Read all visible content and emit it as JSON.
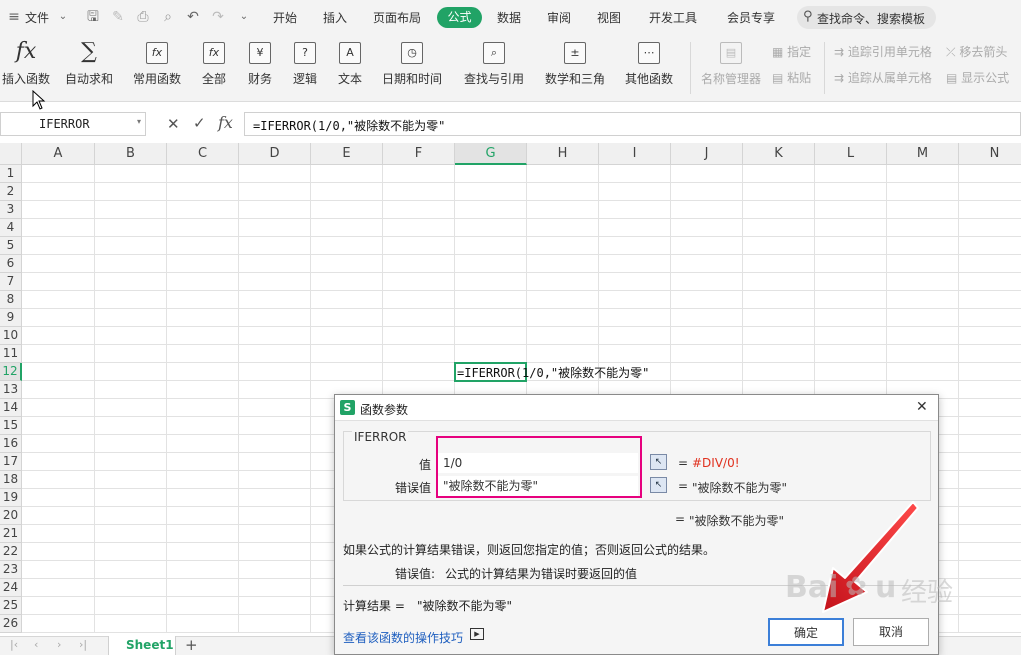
{
  "menubar": {
    "file_label": "文件",
    "tabs": [
      "开始",
      "插入",
      "页面布局",
      "公式",
      "数据",
      "审阅",
      "视图",
      "开发工具",
      "会员专享"
    ],
    "active_tab": "公式",
    "search_placeholder": "查找命令、搜索模板"
  },
  "ribbon": {
    "insert_function": "插入函数",
    "autosum": "自动求和",
    "common_functions": "常用函数",
    "all": "全部",
    "finance": "财务",
    "logic": "逻辑",
    "text": "文本",
    "datetime": "日期和时间",
    "lookup": "查找与引用",
    "math": "数学和三角",
    "other": "其他函数",
    "name_manager": "名称管理器",
    "specify": "指定",
    "paste": "粘贴",
    "trace_precedents": "追踪引用单元格",
    "trace_dependents": "追踪从属单元格",
    "remove_arrows": "移去箭头",
    "show_formulas": "显示公式",
    "icons": {
      "insert_function": "fx",
      "autosum": "∑",
      "common_functions": "fx",
      "all": "fx",
      "finance": "¥",
      "logic": "?",
      "text": "A"
    }
  },
  "formula_bar": {
    "name_box": "IFERROR",
    "formula": "=IFERROR(1/0,\"被除数不能为零\""
  },
  "grid": {
    "columns": [
      "A",
      "B",
      "C",
      "D",
      "E",
      "F",
      "G",
      "H",
      "I",
      "J",
      "K",
      "L",
      "M",
      "N"
    ],
    "rows": [
      "1",
      "2",
      "3",
      "4",
      "5",
      "6",
      "7",
      "8",
      "9",
      "10",
      "11",
      "12",
      "13",
      "14",
      "15",
      "16",
      "17",
      "18",
      "19",
      "20",
      "21",
      "22",
      "23",
      "24",
      "25",
      "26"
    ],
    "active_column": "G",
    "active_row": "12",
    "cell_text": "=IFERROR(1/0,\"被除数不能为零\""
  },
  "sheet_tabs": {
    "active": "Sheet1",
    "add": "+"
  },
  "dialog": {
    "title": "函数参数",
    "function_name": "IFERROR",
    "value_label": "值",
    "value_input": "1/0",
    "value_result": "#DIV/0!",
    "error_label": "错误值",
    "error_input": "\"被除数不能为零\"",
    "error_result": "\"被除数不能为零\"",
    "equals": "=",
    "overall_result": "\"被除数不能为零\"",
    "description": "如果公式的计算结果错误，则返回您指定的值；否则返回公式的结果。",
    "param_help_name": "错误值:",
    "param_help_text": "公式的计算结果为错误时要返回的值",
    "calc_result_label": "计算结果 =",
    "calc_result_value": "\"被除数不能为零\"",
    "help_link": "查看该函数的操作技巧",
    "ok": "确定",
    "cancel": "取消",
    "close": "✕"
  },
  "colors": {
    "accent_green": "#21a366",
    "error_red": "#e0301e",
    "highlight_pink": "#e6007e",
    "arrow_red": "#e8202a"
  }
}
